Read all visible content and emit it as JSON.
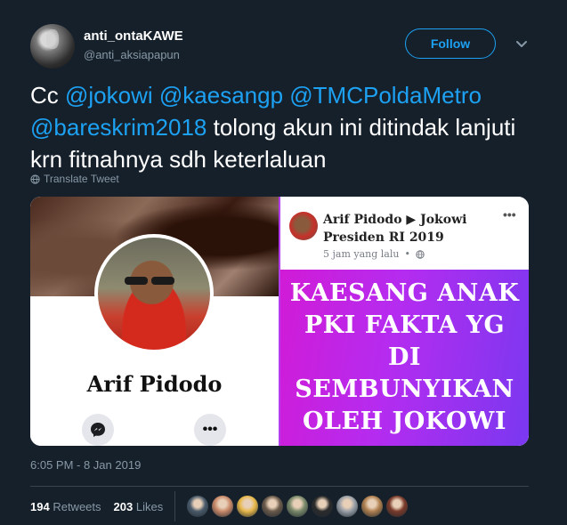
{
  "user": {
    "display_name": "anti_ontaKAWE",
    "handle": "@anti_aksiapapun",
    "avatar_icon": "user-avatar"
  },
  "follow_label": "Follow",
  "tweet": {
    "prefix": "Cc ",
    "mentions": [
      "@jokowi",
      "@kaesangp",
      "@TMCPoldaMetro",
      "@bareskrim2018"
    ],
    "text": "tolong akun ini ditindak lanjuti krn fitnahnya sdh keterlaluan",
    "translate_label": "Translate Tweet"
  },
  "media": {
    "left": {
      "profile_name": "Arif Pidodo",
      "messenger_icon": "messenger-icon",
      "more_label": "•••"
    },
    "right": {
      "author": "Arif Pidodo ▶ Jokowi Presiden RI 2019",
      "time": "5 jam yang lalu",
      "dot": "•",
      "more_label": "•••",
      "image_text": "KAESANG ANAK PKI FAKTA YG DI SEMBUNYIKAN OLEH JOKOWI"
    }
  },
  "timestamp": "6:05 PM - 8 Jan 2019",
  "stats": {
    "retweets_count": "194",
    "retweets_label": "Retweets",
    "likes_count": "203",
    "likes_label": "Likes"
  },
  "likers": [
    {
      "color": "#4a5a6a"
    },
    {
      "color": "#c98a6a"
    },
    {
      "color": "#e8b84a"
    },
    {
      "color": "#6a5a4a"
    },
    {
      "color": "#7a8a6a"
    },
    {
      "color": "#2a2a2a"
    },
    {
      "color": "#9aa0a8"
    },
    {
      "color": "#b08050"
    },
    {
      "color": "#7a3a2a"
    }
  ],
  "colors": {
    "background": "#15202b",
    "accent": "#1da1f2",
    "muted": "#8899a6",
    "post_image_gradient": [
      "#d11bd6",
      "#7a38f0"
    ]
  }
}
